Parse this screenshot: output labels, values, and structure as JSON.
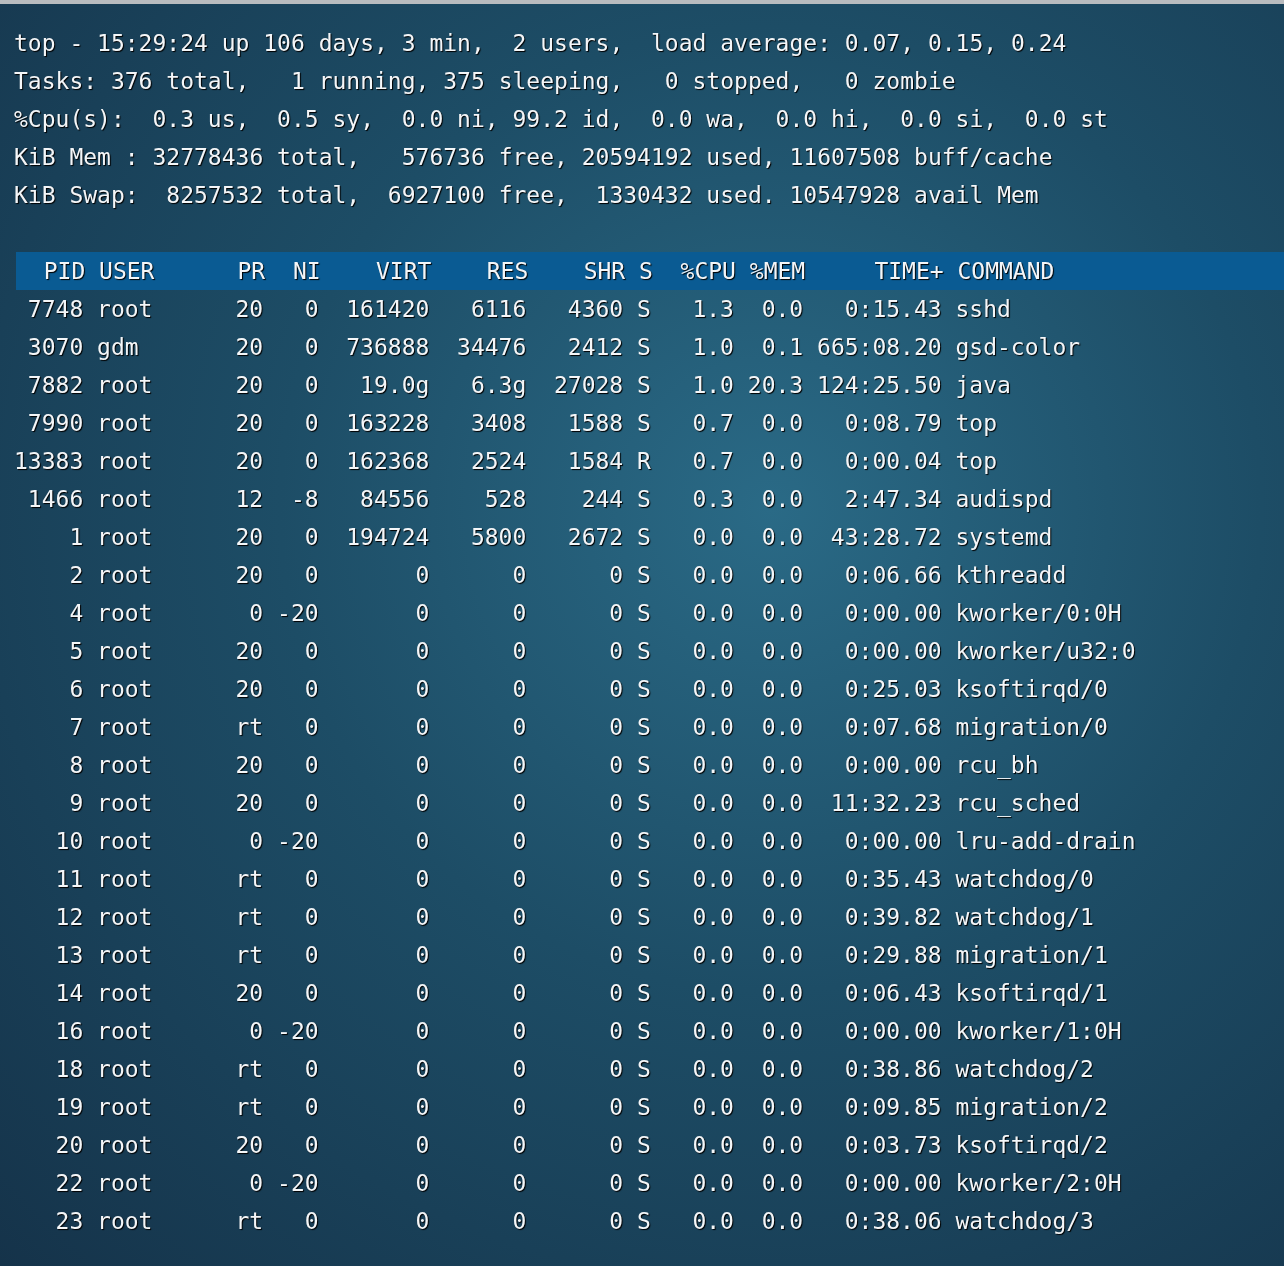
{
  "summary_lines": [
    "top - 15:29:24 up 106 days, 3 min,  2 users,  load average: 0.07, 0.15, 0.24",
    "Tasks: 376 total,   1 running, 375 sleeping,   0 stopped,   0 zombie",
    "%Cpu(s):  0.3 us,  0.5 sy,  0.0 ni, 99.2 id,  0.0 wa,  0.0 hi,  0.0 si,  0.0 st",
    "KiB Mem : 32778436 total,   576736 free, 20594192 used, 11607508 buff/cache",
    "KiB Swap:  8257532 total,  6927100 free,  1330432 used. 10547928 avail Mem"
  ],
  "process_table": {
    "columns": [
      "PID",
      "USER",
      "PR",
      "NI",
      "VIRT",
      "RES",
      "SHR",
      "S",
      "%CPU",
      "%MEM",
      "TIME+",
      "COMMAND"
    ],
    "rows": [
      [
        "7748",
        "root",
        "20",
        "0",
        "161420",
        "6116",
        "4360",
        "S",
        "1.3",
        "0.0",
        "0:15.43",
        "sshd"
      ],
      [
        "3070",
        "gdm",
        "20",
        "0",
        "736888",
        "34476",
        "2412",
        "S",
        "1.0",
        "0.1",
        "665:08.20",
        "gsd-color"
      ],
      [
        "7882",
        "root",
        "20",
        "0",
        "19.0g",
        "6.3g",
        "27028",
        "S",
        "1.0",
        "20.3",
        "124:25.50",
        "java"
      ],
      [
        "7990",
        "root",
        "20",
        "0",
        "163228",
        "3408",
        "1588",
        "S",
        "0.7",
        "0.0",
        "0:08.79",
        "top"
      ],
      [
        "13383",
        "root",
        "20",
        "0",
        "162368",
        "2524",
        "1584",
        "R",
        "0.7",
        "0.0",
        "0:00.04",
        "top"
      ],
      [
        "1466",
        "root",
        "12",
        "-8",
        "84556",
        "528",
        "244",
        "S",
        "0.3",
        "0.0",
        "2:47.34",
        "audispd"
      ],
      [
        "1",
        "root",
        "20",
        "0",
        "194724",
        "5800",
        "2672",
        "S",
        "0.0",
        "0.0",
        "43:28.72",
        "systemd"
      ],
      [
        "2",
        "root",
        "20",
        "0",
        "0",
        "0",
        "0",
        "S",
        "0.0",
        "0.0",
        "0:06.66",
        "kthreadd"
      ],
      [
        "4",
        "root",
        "0",
        "-20",
        "0",
        "0",
        "0",
        "S",
        "0.0",
        "0.0",
        "0:00.00",
        "kworker/0:0H"
      ],
      [
        "5",
        "root",
        "20",
        "0",
        "0",
        "0",
        "0",
        "S",
        "0.0",
        "0.0",
        "0:00.00",
        "kworker/u32:0"
      ],
      [
        "6",
        "root",
        "20",
        "0",
        "0",
        "0",
        "0",
        "S",
        "0.0",
        "0.0",
        "0:25.03",
        "ksoftirqd/0"
      ],
      [
        "7",
        "root",
        "rt",
        "0",
        "0",
        "0",
        "0",
        "S",
        "0.0",
        "0.0",
        "0:07.68",
        "migration/0"
      ],
      [
        "8",
        "root",
        "20",
        "0",
        "0",
        "0",
        "0",
        "S",
        "0.0",
        "0.0",
        "0:00.00",
        "rcu_bh"
      ],
      [
        "9",
        "root",
        "20",
        "0",
        "0",
        "0",
        "0",
        "S",
        "0.0",
        "0.0",
        "11:32.23",
        "rcu_sched"
      ],
      [
        "10",
        "root",
        "0",
        "-20",
        "0",
        "0",
        "0",
        "S",
        "0.0",
        "0.0",
        "0:00.00",
        "lru-add-drain"
      ],
      [
        "11",
        "root",
        "rt",
        "0",
        "0",
        "0",
        "0",
        "S",
        "0.0",
        "0.0",
        "0:35.43",
        "watchdog/0"
      ],
      [
        "12",
        "root",
        "rt",
        "0",
        "0",
        "0",
        "0",
        "S",
        "0.0",
        "0.0",
        "0:39.82",
        "watchdog/1"
      ],
      [
        "13",
        "root",
        "rt",
        "0",
        "0",
        "0",
        "0",
        "S",
        "0.0",
        "0.0",
        "0:29.88",
        "migration/1"
      ],
      [
        "14",
        "root",
        "20",
        "0",
        "0",
        "0",
        "0",
        "S",
        "0.0",
        "0.0",
        "0:06.43",
        "ksoftirqd/1"
      ],
      [
        "16",
        "root",
        "0",
        "-20",
        "0",
        "0",
        "0",
        "S",
        "0.0",
        "0.0",
        "0:00.00",
        "kworker/1:0H"
      ],
      [
        "18",
        "root",
        "rt",
        "0",
        "0",
        "0",
        "0",
        "S",
        "0.0",
        "0.0",
        "0:38.86",
        "watchdog/2"
      ],
      [
        "19",
        "root",
        "rt",
        "0",
        "0",
        "0",
        "0",
        "S",
        "0.0",
        "0.0",
        "0:09.85",
        "migration/2"
      ],
      [
        "20",
        "root",
        "20",
        "0",
        "0",
        "0",
        "0",
        "S",
        "0.0",
        "0.0",
        "0:03.73",
        "ksoftirqd/2"
      ],
      [
        "22",
        "root",
        "0",
        "-20",
        "0",
        "0",
        "0",
        "S",
        "0.0",
        "0.0",
        "0:00.00",
        "kworker/2:0H"
      ],
      [
        "23",
        "root",
        "rt",
        "0",
        "0",
        "0",
        "0",
        "S",
        "0.0",
        "0.0",
        "0:38.06",
        "watchdog/3"
      ]
    ]
  }
}
